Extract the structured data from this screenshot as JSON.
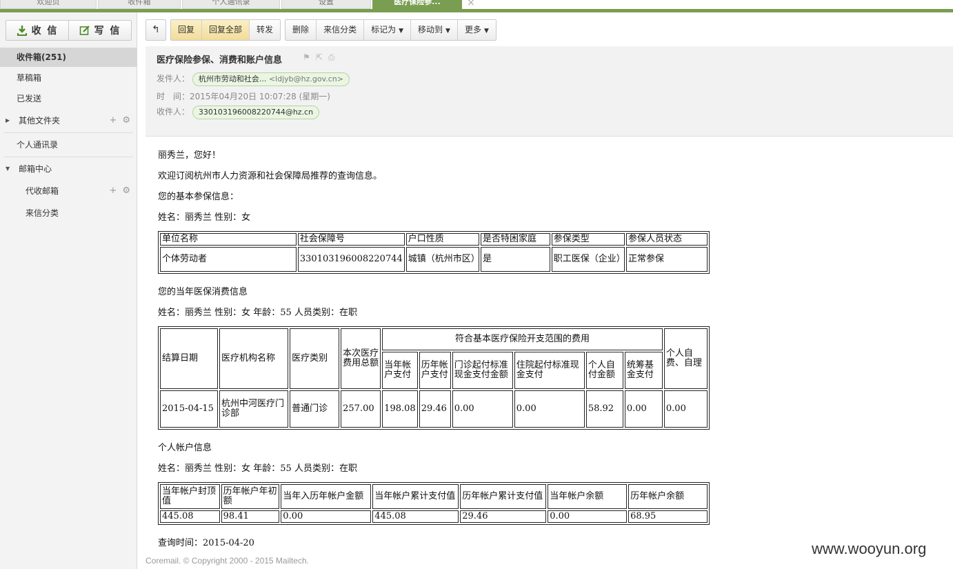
{
  "tabs": [
    "欢迎页",
    "收件箱",
    "个人通讯录",
    "设置",
    "医疗保险参..."
  ],
  "sidebar": {
    "receive_label": "收 信",
    "compose_label": "写 信",
    "folders": {
      "inbox": "收件箱(251)",
      "drafts": "草稿箱",
      "sent": "已发送",
      "other": "其他文件夹",
      "contacts": "个人通讯录",
      "mailcenter": "邮箱中心",
      "proxy": "代收邮箱",
      "classify": "来信分类"
    }
  },
  "toolbar": {
    "back": "↰",
    "reply": "回复",
    "reply_all": "回复全部",
    "forward": "转发",
    "delete": "删除",
    "sort": "来信分类",
    "mark": "标记为",
    "move": "移动到",
    "more": "更多"
  },
  "header": {
    "subject": "医疗保险参保、消费和账户信息",
    "from_label": "发件人：",
    "from_name": "杭州市劳动和社会...",
    "from_addr": "<ldjyb@hz.gov.cn>",
    "time_label": "时　间：",
    "time_value": "2015年04月20日 10:07:28 (星期一)",
    "to_label": "收件人：",
    "to_value": "330103196008220744@hz.cn"
  },
  "body": {
    "greeting": "丽秀兰，您好！",
    "intro": "欢迎订阅杭州市人力资源和社会保障局推荐的查询信息。",
    "basic_title": "您的基本参保信息：",
    "basic_person": "姓名：丽秀兰 性别：女",
    "basic_table": {
      "headers": [
        "单位名称",
        "社会保障号",
        "户口性质",
        "是否特困家庭",
        "参保类型",
        "参保人员状态"
      ],
      "row": [
        "个体劳动者",
        "330103196008220744",
        "城镇（杭州市区）",
        "是",
        "职工医保（企业）",
        "正常参保"
      ]
    },
    "consume_title": "您的当年医保消费信息",
    "consume_person": "姓名：丽秀兰 性别：女 年龄：55 人员类别：在职",
    "consume_table": {
      "h_date": "结算日期",
      "h_org": "医疗机构名称",
      "h_type": "医疗类别",
      "h_total": "本次医疗费用总额",
      "h_group": "符合基本医疗保险开支范围的费用",
      "h_sub": [
        "当年帐户支付",
        "历年帐户支付",
        "门诊起付标准现金支付金额",
        "住院起付标准现金支付",
        "个人自付金额",
        "统筹基金支付"
      ],
      "h_self": "个人自费、自理",
      "row": [
        "2015-04-15",
        "杭州中河医疗门诊部",
        "普通门诊",
        "257.00",
        "198.08",
        "29.46",
        "0.00",
        "0.00",
        "58.92",
        "0.00",
        "0.00"
      ]
    },
    "account_title": "个人帐户信息",
    "account_person": "姓名：丽秀兰 性别：女 年龄：55 人员类别：在职",
    "account_table": {
      "headers": [
        "当年帐户封顶值",
        "历年帐户年初额",
        "当年入历年帐户金额",
        "当年帐户累计支付值",
        "历年帐户累计支付值",
        "当年帐户余额",
        "历年帐户余额"
      ],
      "row": [
        "445.08",
        "98.41",
        "0.00",
        "445.08",
        "29.46",
        "0.00",
        "68.95"
      ]
    },
    "query_time": "查询时间：2015-04-20"
  },
  "footer": "Coremail. © Copyright 2000 - 2015 Mailtech.",
  "watermark": "www.wooyun.org"
}
